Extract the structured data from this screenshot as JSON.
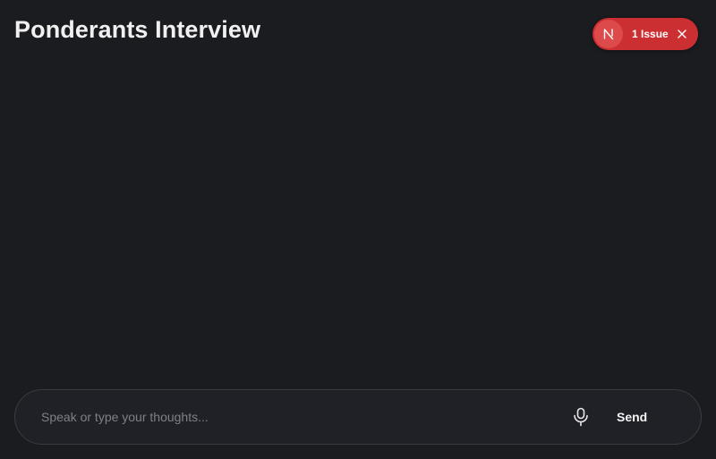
{
  "header": {
    "title": "Ponderants Interview"
  },
  "issue_badge": {
    "logo_letter": "N",
    "label": "1 Issue",
    "logo_icon": "nextjs-logo-icon",
    "close_icon": "close-icon",
    "color": "#cc2f31"
  },
  "composer": {
    "placeholder": "Speak or type your thoughts...",
    "value": "",
    "mic_icon": "microphone-icon",
    "send_label": "Send"
  },
  "colors": {
    "background": "#1b1c20",
    "input_background": "#202126",
    "input_border": "#3a3b41"
  }
}
